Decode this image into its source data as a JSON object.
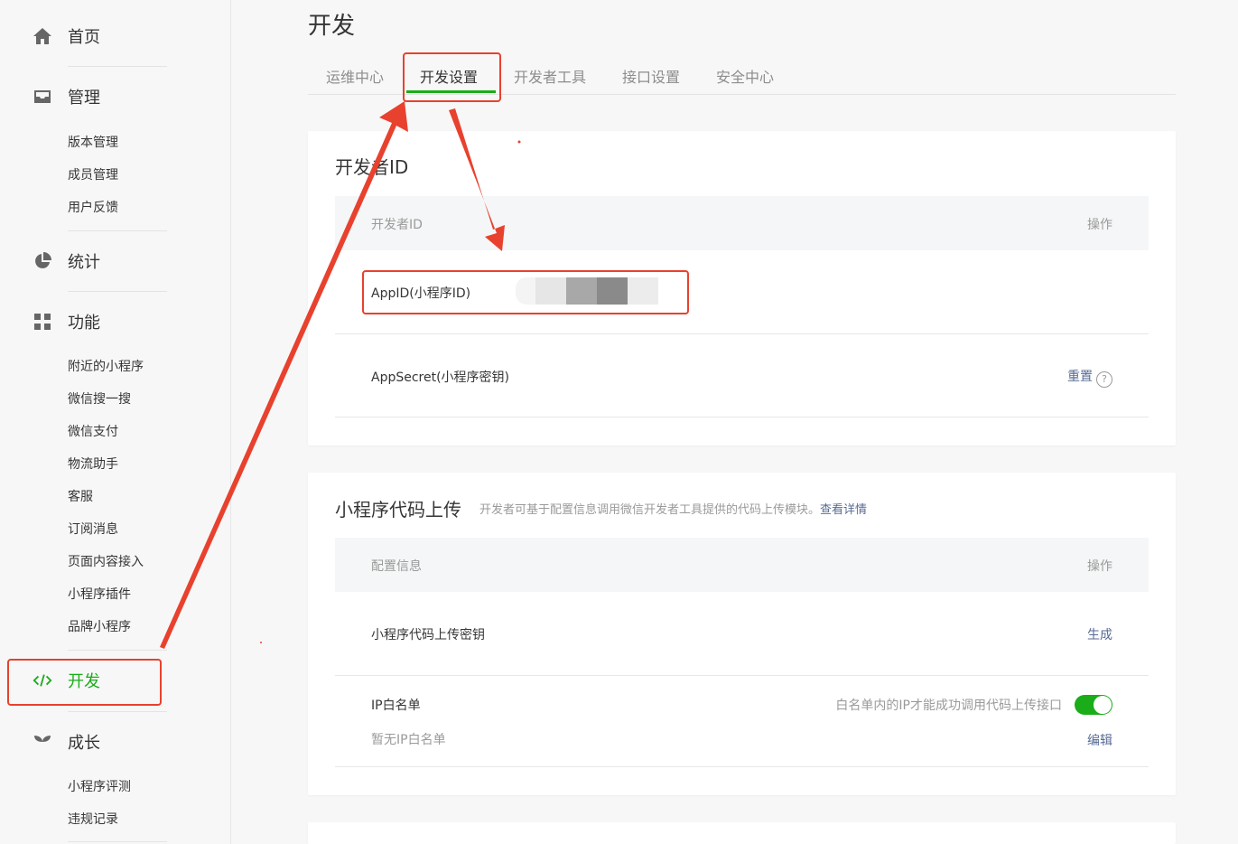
{
  "sidebar": {
    "categories": {
      "home": "首页",
      "manage": "管理",
      "stats": "统计",
      "features": "功能",
      "develop": "开发",
      "growth": "成长"
    },
    "manage_items": [
      "版本管理",
      "成员管理",
      "用户反馈"
    ],
    "feature_items": [
      "附近的小程序",
      "微信搜一搜",
      "微信支付",
      "物流助手",
      "客服",
      "订阅消息",
      "页面内容接入",
      "小程序插件",
      "品牌小程序"
    ],
    "growth_items": [
      "小程序评测",
      "违规记录"
    ]
  },
  "page": {
    "title": "开发"
  },
  "tabs": [
    "运维中心",
    "开发设置",
    "开发者工具",
    "接口设置",
    "安全中心"
  ],
  "dev_id_card": {
    "title": "开发者ID",
    "col_name": "开发者ID",
    "col_action": "操作",
    "appid_label": "AppID(小程序ID)",
    "appsecret_label": "AppSecret(小程序密钥)",
    "reset_link": "重置",
    "help_glyph": "?"
  },
  "upload_card": {
    "title": "小程序代码上传",
    "desc": "开发者可基于配置信息调用微信开发者工具提供的代码上传模块。",
    "detail_link": "查看详情",
    "col_name": "配置信息",
    "col_action": "操作",
    "key_label": "小程序代码上传密钥",
    "generate_link": "生成",
    "ip_label": "IP白名单",
    "ip_hint": "白名单内的IP才能成功调用代码上传接口",
    "ip_empty": "暂无IP白名单",
    "edit_link": "编辑",
    "ip_toggle_on": true
  },
  "colors": {
    "accent": "#1aad19",
    "link": "#576b95",
    "annotation": "#e8412e"
  }
}
